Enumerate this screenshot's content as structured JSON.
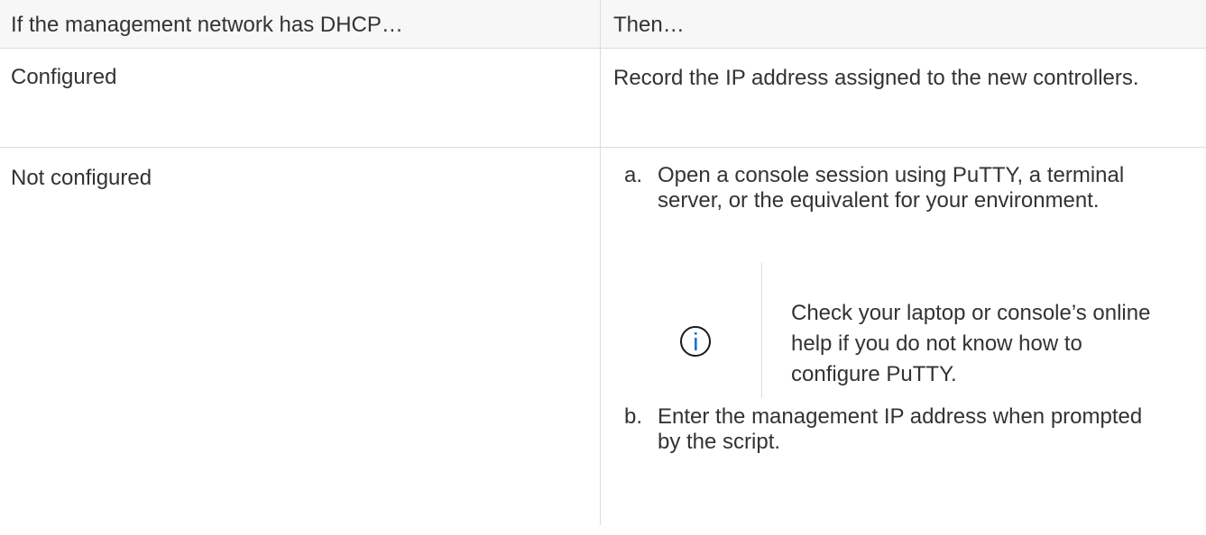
{
  "table": {
    "header": {
      "col1": "If the management network has DHCP…",
      "col2": "Then…"
    },
    "rows": [
      {
        "condition": "Configured",
        "action": "Record the IP address assigned to the new controllers."
      },
      {
        "condition": "Not configured",
        "steps": [
          {
            "marker": "a.",
            "text": "Open a console session using PuTTY, a terminal server, or the equivalent for your environment."
          },
          {
            "marker": "b.",
            "text": "Enter the management IP address when prompted by the script."
          }
        ],
        "note": {
          "icon": "info-icon",
          "text": "Check your laptop or console’s online help if you do not know how to configure PuTTY."
        }
      }
    ]
  },
  "colors": {
    "text": "#333333",
    "border": "#dcdcdc",
    "header_bg": "#f7f7f7",
    "icon_accent": "#1f6fd1"
  }
}
